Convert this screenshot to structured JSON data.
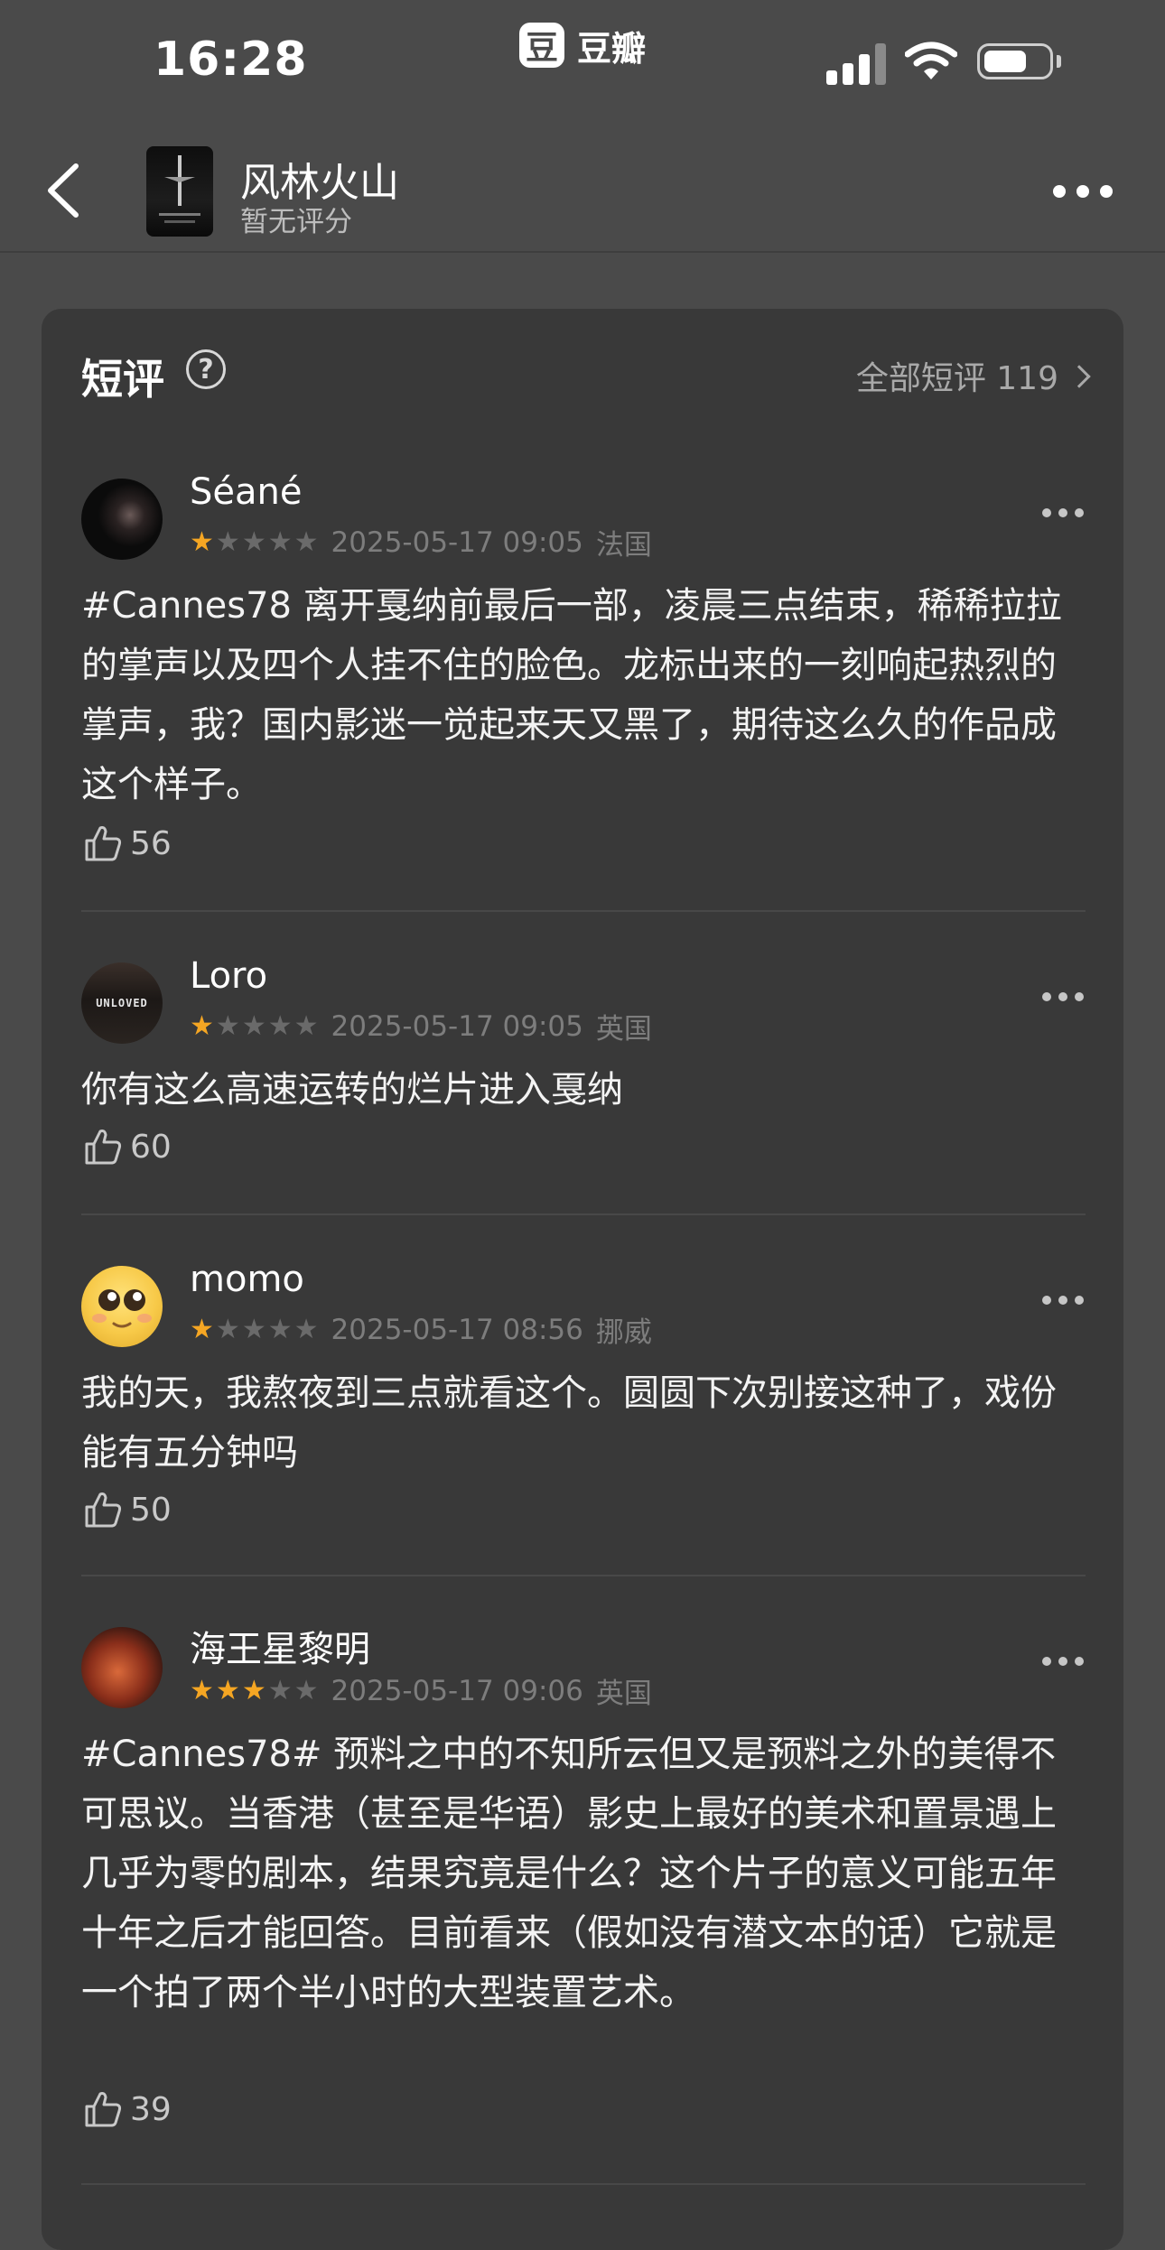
{
  "status_bar": {
    "time": "16:28",
    "app_badge": "豆",
    "app_name": "豆瓣",
    "battery_percent": 65
  },
  "header": {
    "title": "风林火山",
    "subtitle": "暂无评分"
  },
  "section": {
    "title": "短评",
    "help_glyph": "?",
    "all_link": "全部短评 119"
  },
  "colors": {
    "background": "#4a4a4a",
    "card": "#393939",
    "star_active": "#f5a623",
    "star_inactive": "#6a6a6a"
  },
  "reviews": [
    {
      "user": "Séané",
      "rating": 1,
      "max_rating": 5,
      "datetime": "2025-05-17 09:05",
      "location": "法国",
      "text": "#Cannes78 离开戛纳前最后一部，凌晨三点结束，稀稀拉拉的掌声以及四个人挂不住的脸色。龙标出来的一刻响起热烈的掌声，我？国内影迷一觉起来天又黑了，期待这么久的作品成这个样子。",
      "likes": "56"
    },
    {
      "user": "Loro",
      "avatar_text": "UNLOVED",
      "rating": 1,
      "max_rating": 5,
      "datetime": "2025-05-17 09:05",
      "location": "英国",
      "text": "你有这么高速运转的烂片进入戛纳",
      "likes": "60"
    },
    {
      "user": "momo",
      "rating": 1,
      "max_rating": 5,
      "datetime": "2025-05-17 08:56",
      "location": "挪威",
      "text": "我的天，我熬夜到三点就看这个。圆圆下次别接这种了，戏份能有五分钟吗",
      "likes": "50"
    },
    {
      "user": "海王星黎明",
      "rating": 3,
      "max_rating": 5,
      "datetime": "2025-05-17 09:06",
      "location": "英国",
      "text": "#Cannes78# 预料之中的不知所云但又是预料之外的美得不可思议。当香港（甚至是华语）影史上最好的美术和置景遇上几乎为零的剧本，结果究竟是什么？这个片子的意义可能五年十年之后才能回答。目前看来（假如没有潜文本的话）它就是一个拍了两个半小时的大型装置艺术。",
      "likes": "39"
    }
  ]
}
